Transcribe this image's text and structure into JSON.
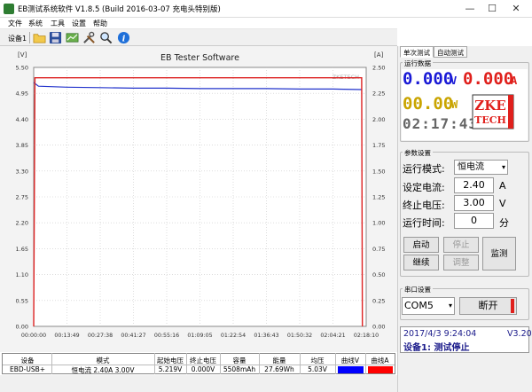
{
  "window": {
    "title": "EB测试系统软件 V1.8.5 (Build 2016-03-07 充电头特别版)",
    "min_glyph": "—",
    "max_glyph": "☐",
    "close_glyph": "✕"
  },
  "menu": [
    "文件",
    "系统",
    "工具",
    "设置",
    "帮助"
  ],
  "toolbar": {
    "device_label": "设备1"
  },
  "chart_data": {
    "type": "line",
    "title": "EB Tester Software",
    "left_unit": "[V]",
    "right_unit": "[A]",
    "watermark_top": "ZKETECH",
    "y_left": {
      "min": 0.0,
      "max": 5.5,
      "ticks": [
        "5.50",
        "4.95",
        "4.40",
        "3.85",
        "3.30",
        "2.75",
        "2.20",
        "1.65",
        "1.10",
        "0.55",
        "0.00"
      ]
    },
    "y_right": {
      "min": 0.0,
      "max": 2.5,
      "ticks": [
        "2.50",
        "2.25",
        "2.00",
        "1.75",
        "1.50",
        "1.25",
        "1.00",
        "0.75",
        "0.50",
        "0.25",
        "0.00"
      ]
    },
    "x_ticks": [
      "00:00:00",
      "00:13:49",
      "00:27:38",
      "00:41:27",
      "00:55:16",
      "01:09:05",
      "01:22:54",
      "01:36:43",
      "01:50:32",
      "02:04:21",
      "02:18:10"
    ],
    "x_range_minutes": [
      0,
      138.17
    ],
    "grid": true,
    "series": [
      {
        "axis": "left",
        "color": "#2233cc",
        "x": [
          0,
          2,
          13.8,
          27.6,
          41.4,
          55.3,
          69.1,
          82.9,
          96.7,
          110.5,
          124.4,
          136.5
        ],
        "values": [
          5.18,
          5.1,
          5.08,
          5.07,
          5.06,
          5.06,
          5.05,
          5.05,
          5.05,
          5.04,
          5.04,
          5.03
        ]
      },
      {
        "axis": "right",
        "color": "#dd2222",
        "x": [
          0,
          0.5,
          136.3,
          136.6
        ],
        "values": [
          0.0,
          2.4,
          2.4,
          0.0
        ]
      }
    ]
  },
  "table": {
    "headers": [
      "设备",
      "模式",
      "起始电压",
      "终止电压",
      "容量",
      "能量",
      "均压",
      "曲线V",
      "曲线A"
    ],
    "row": [
      "EBD-USB+",
      "恒电流  2.40A  3.00V",
      "5.219V",
      "0.000V",
      "5508mAh",
      "27.69Wh",
      "5.03V",
      "",
      ""
    ],
    "curve_v_color": "#0000ff",
    "curve_a_color": "#ff0000"
  },
  "panel": {
    "tabs": [
      "单次测试",
      "自动测试"
    ],
    "data_group": "运行数据",
    "voltage": "0.000",
    "voltage_unit": "V",
    "current": "0.000",
    "current_unit": "A",
    "power": "00.00",
    "power_unit": "W",
    "timer": "02:17:43",
    "logo_line1": "ZKE",
    "logo_line2": "TECH",
    "param_group": "参数设置",
    "mode_label": "运行模式:",
    "mode_value": "恒电流",
    "current_label": "设定电流:",
    "current_value": "2.40",
    "current_set_unit": "A",
    "cutoff_label": "终止电压:",
    "cutoff_value": "3.00",
    "cutoff_unit": "V",
    "time_label": "运行时间:",
    "time_value": "0",
    "time_unit": "分",
    "btn_start": "启动",
    "btn_stop": "停止",
    "btn_continue": "继续",
    "btn_adjust": "调整",
    "btn_monitor": "监测",
    "serial_group": "串口设置",
    "com_port": "COM5",
    "btn_disconnect": "断开",
    "status_time": "2017/4/3 9:24:04",
    "status_version": "V3.20",
    "status_device": "设备1: 测试停止"
  },
  "colors": {
    "lcd_blue": "#1a1ad6",
    "lcd_red": "#e0201c",
    "lcd_gold": "#c9a400",
    "lcd_gray": "#666666",
    "plot_border": "#e02020"
  }
}
